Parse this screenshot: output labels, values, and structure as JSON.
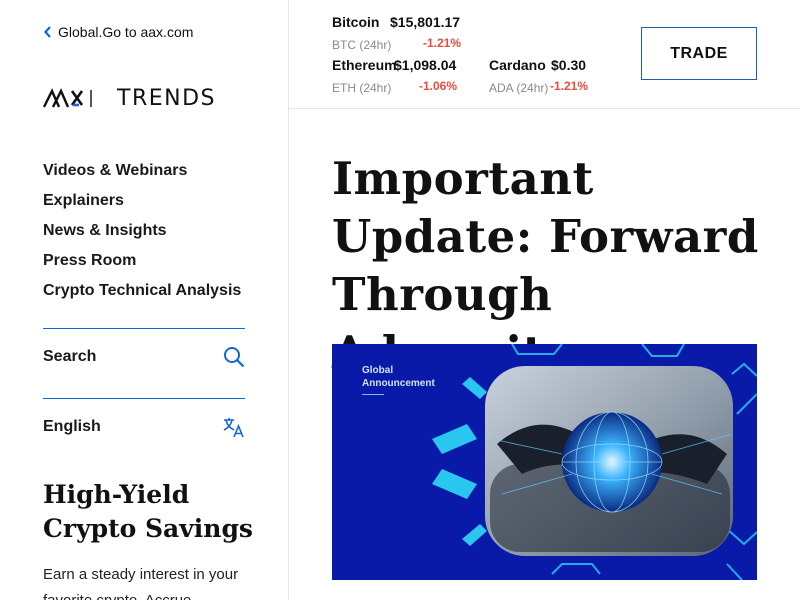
{
  "sidebar": {
    "back_link": "Global.Go to aax.com",
    "logo_text": "TRENDS",
    "nav": [
      "Videos & Webinars",
      "Explainers",
      "News & Insights",
      "Press Room",
      "Crypto Technical Analysis"
    ],
    "search_label": "Search",
    "language_label": "English",
    "promo_title": "High-Yield Crypto Savings",
    "promo_text": "Earn a steady interest in your favorite crypto. Accrue"
  },
  "ticker": {
    "btc": {
      "name": "Bitcoin",
      "price": "$15,801.17",
      "sub": "BTC (24hr)",
      "change": "-1.21%"
    },
    "eth": {
      "name": "Ethereum",
      "price": "$1,098.04",
      "sub": "ETH (24hr)",
      "change": "-1.06%"
    },
    "ada": {
      "name": "Cardano",
      "price": "$0.30",
      "sub": "ADA (24hr)",
      "change": "-1.21%"
    },
    "trade_label": "TRADE"
  },
  "article": {
    "title": "Important Update: Forward Through Adversity",
    "banner_tag": "Global Announcement"
  },
  "colors": {
    "accent": "#1167d4",
    "negative": "#e74c3c",
    "banner_bg": "#0a1aa8",
    "banner_accent": "#29c6f0"
  },
  "icons": {
    "back": "chevron-left-icon",
    "search": "search-icon",
    "language": "translate-icon"
  }
}
